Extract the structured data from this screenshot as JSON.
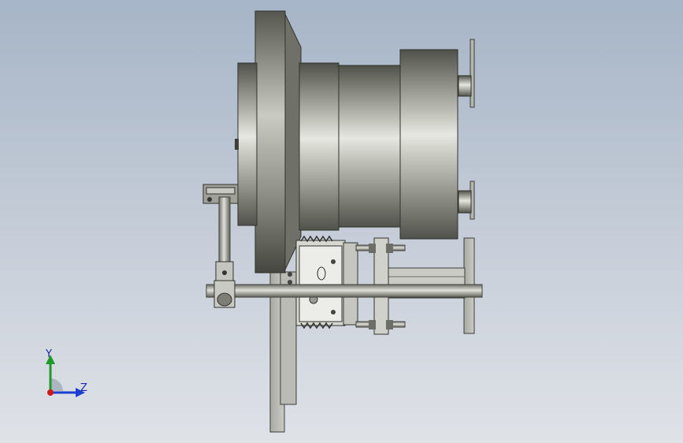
{
  "viewport": {
    "background_top": "#a6b5c7",
    "background_bottom": "#dfe2e7"
  },
  "triad": {
    "y_label": "Y",
    "z_label": "Z",
    "y_color": "#1f9a2a",
    "z_color": "#1d3fd1",
    "x_color": "#d01818"
  },
  "model": {
    "steel_light": "#e4e6e0",
    "steel_dark": "#5b5d54",
    "plate_color": "#c4c6c0"
  }
}
